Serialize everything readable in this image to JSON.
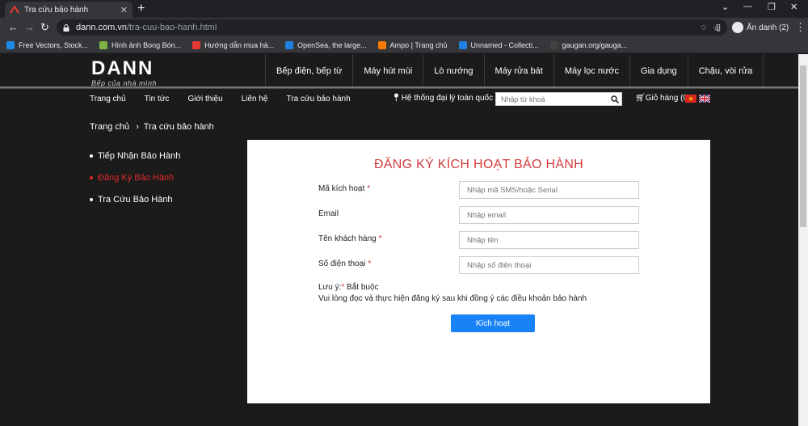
{
  "browser": {
    "tab_title": "Tra cứu bảo hành",
    "url_host": "dann.com.vn",
    "url_path": "/tra-cuu-bao-hanh.html",
    "incognito_label": "Ẩn danh (2)",
    "bookmarks": [
      {
        "label": "Free Vectors, Stock...",
        "color": "#1e88e5"
      },
      {
        "label": "Hình ảnh Bong Bón...",
        "color": "#7cb342"
      },
      {
        "label": "Hướng dẫn mua hà...",
        "color": "#e53935"
      },
      {
        "label": "OpenSea, the large...",
        "color": "#2081e2"
      },
      {
        "label": "Ampo | Trang chủ",
        "color": "#f57c00"
      },
      {
        "label": "Unnamed - Collecti...",
        "color": "#2081e2"
      },
      {
        "label": "gaugan.org/gauga...",
        "color": "#424242"
      }
    ]
  },
  "site": {
    "logo_word": "DANN",
    "logo_tagline": "Bếp của nhà mình",
    "categories": [
      "Bếp điện, bếp từ",
      "Máy hút mùi",
      "Lò nướng",
      "Máy rửa bát",
      "Máy lọc nước",
      "Gia dụng",
      "Chậu, vòi rửa"
    ],
    "sub_links": [
      "Trang chủ",
      "Tin tức",
      "Giới thiệu",
      "Liên hệ",
      "Tra cứu bảo hành"
    ],
    "agent_label": "Hệ thống đại lý toàn quốc",
    "search_placeholder": "Nhập từ khoá",
    "cart_label": "Giỏ hàng (0)"
  },
  "breadcrumb": {
    "home": "Trang chủ",
    "separator": "›",
    "current": "Tra cứu bảo hành"
  },
  "sidemenu": [
    {
      "label": "Tiếp Nhận Bảo Hành",
      "active": false
    },
    {
      "label": "Đăng Ký Bảo Hành",
      "active": true
    },
    {
      "label": "Tra Cứu Bảo Hành",
      "active": false
    }
  ],
  "form": {
    "title": "ĐĂNG KÝ KÍCH HOẠT BẢO HÀNH",
    "fields": [
      {
        "label": "Mã kích hoạt",
        "required": "*",
        "placeholder": "Nhập mã SMS/hoặc Serial"
      },
      {
        "label": "Email",
        "required": "",
        "placeholder": "Nhập email"
      },
      {
        "label": "Tên khách hàng",
        "required": "*",
        "placeholder": "Nhập tên"
      },
      {
        "label": "Số điện thoại",
        "required": "*",
        "placeholder": "Nhập số điện thoại"
      }
    ],
    "note_prefix": "Lưu ý:",
    "note_required_mark": "*",
    "note_required_text": " Bắt buộc",
    "note_line2": "Vui lòng đọc và thực hiện đăng ký sau khi đồng ý các điều khoản bảo hành",
    "submit_label": "Kích hoạt"
  },
  "colors": {
    "accent_red": "#d23b3b",
    "button_blue": "#1a82f7"
  }
}
